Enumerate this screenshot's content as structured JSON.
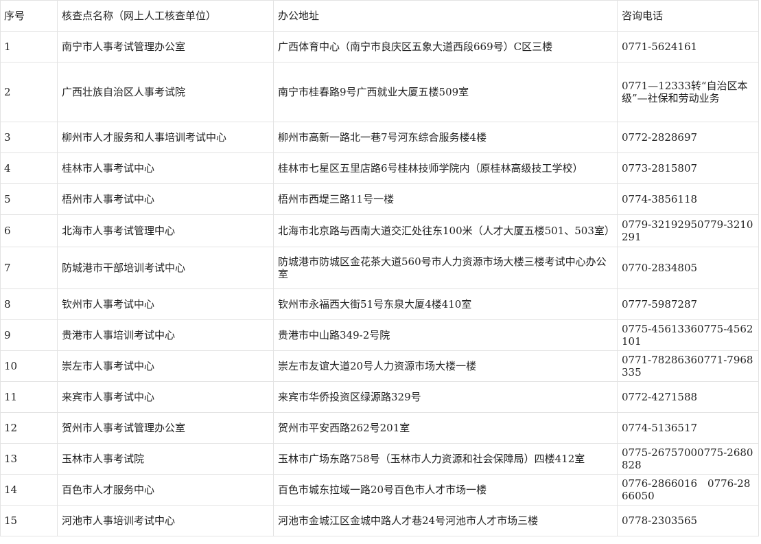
{
  "table": {
    "headers": [
      "序号",
      "核查点名称（网上人工核查单位）",
      "办公地址",
      "咨询电话"
    ],
    "rows": [
      {
        "no": "1",
        "name": "南宁市人事考试管理办公室",
        "address": "广西体育中心（南宁市良庆区五象大道西段669号）C区三楼",
        "phone": "0771-5624161"
      },
      {
        "no": "2",
        "name": "广西壮族自治区人事考试院",
        "address": "南宁市桂春路9号广西就业大厦五楼509室",
        "phone": "0771—12333转“自治区本级”—社保和劳动业务"
      },
      {
        "no": "3",
        "name": "柳州市人才服务和人事培训考试中心",
        "address": "柳州市高新一路北一巷7号河东综合服务楼4楼",
        "phone": "0772-2828697"
      },
      {
        "no": "4",
        "name": "桂林市人事考试中心",
        "address": "桂林市七星区五里店路6号桂林技师学院内（原桂林高级技工学校）",
        "phone": "0773-2815807"
      },
      {
        "no": "5",
        "name": "梧州市人事考试中心",
        "address": "梧州市西堤三路11号一楼",
        "phone": "0774-3856118"
      },
      {
        "no": "6",
        "name": "北海市人事考试管理中心",
        "address": "北海市北京路与西南大道交汇处往东100米（人才大厦五楼501、503室）",
        "phone": "0779-32192950779-3210291"
      },
      {
        "no": "7",
        "name": "防城港市干部培训考试中心",
        "address": "防城港市防城区金花茶大道560号市人力资源市场大楼三楼考试中心办公室",
        "phone": "0770-2834805"
      },
      {
        "no": "8",
        "name": "钦州市人事考试中心",
        "address": "钦州市永福西大街51号东泉大厦4楼410室",
        "phone": "0777-5987287"
      },
      {
        "no": "9",
        "name": "贵港市人事培训考试中心",
        "address": "贵港市中山路349-2号院",
        "phone": "0775-45613360775-4562101"
      },
      {
        "no": "10",
        "name": "崇左市人事考试中心",
        "address": "崇左市友谊大道20号人力资源市场大楼一楼",
        "phone": "0771-78286360771-7968335"
      },
      {
        "no": "11",
        "name": "来宾市人事考试中心",
        "address": "来宾市华侨投资区绿源路329号",
        "phone": "0772-4271588"
      },
      {
        "no": "12",
        "name": "贺州市人事考试管理办公室",
        "address": "贺州市平安西路262号201室",
        "phone": "0774-5136517"
      },
      {
        "no": "13",
        "name": "玉林市人事考试院",
        "address": "玉林市广场东路758号（玉林市人力资源和社会保障局）四楼412室",
        "phone": "0775-26757000775-2680828"
      },
      {
        "no": "14",
        "name": "百色市人才服务中心",
        "address": "百色市城东拉域一路20号百色市人才市场一楼",
        "phone": "0776-2866016　0776-2866050"
      },
      {
        "no": "15",
        "name": "河池市人事培训考试中心",
        "address": "河池市金城江区金城中路人才巷24号河池市人才市场三楼",
        "phone": "0778-2303565"
      }
    ]
  }
}
